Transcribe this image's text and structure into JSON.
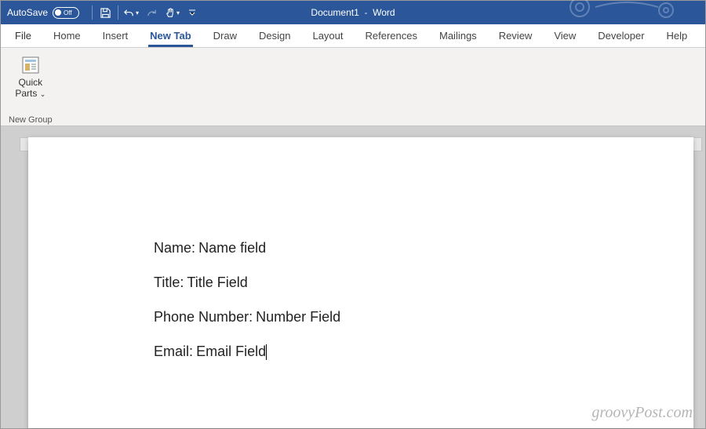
{
  "titlebar": {
    "autosave_label": "AutoSave",
    "autosave_state": "Off",
    "doc_name": "Document1",
    "app_name": "Word"
  },
  "tabs": {
    "file": "File",
    "home": "Home",
    "insert": "Insert",
    "new_tab": "New Tab",
    "draw": "Draw",
    "design": "Design",
    "layout": "Layout",
    "references": "References",
    "mailings": "Mailings",
    "review": "Review",
    "view": "View",
    "developer": "Developer",
    "help": "Help"
  },
  "ribbon": {
    "quick_parts_line1": "Quick",
    "quick_parts_line2": "Parts",
    "group_name": "New Group"
  },
  "document": {
    "lines": [
      {
        "label": "Name:",
        "field": "Name field"
      },
      {
        "label": "Title:",
        "field": "Title Field"
      },
      {
        "label": "Phone Number:",
        "field": "Number Field"
      },
      {
        "label": "Email:",
        "field": "Email Field"
      }
    ]
  },
  "watermark": "groovyPost.com"
}
